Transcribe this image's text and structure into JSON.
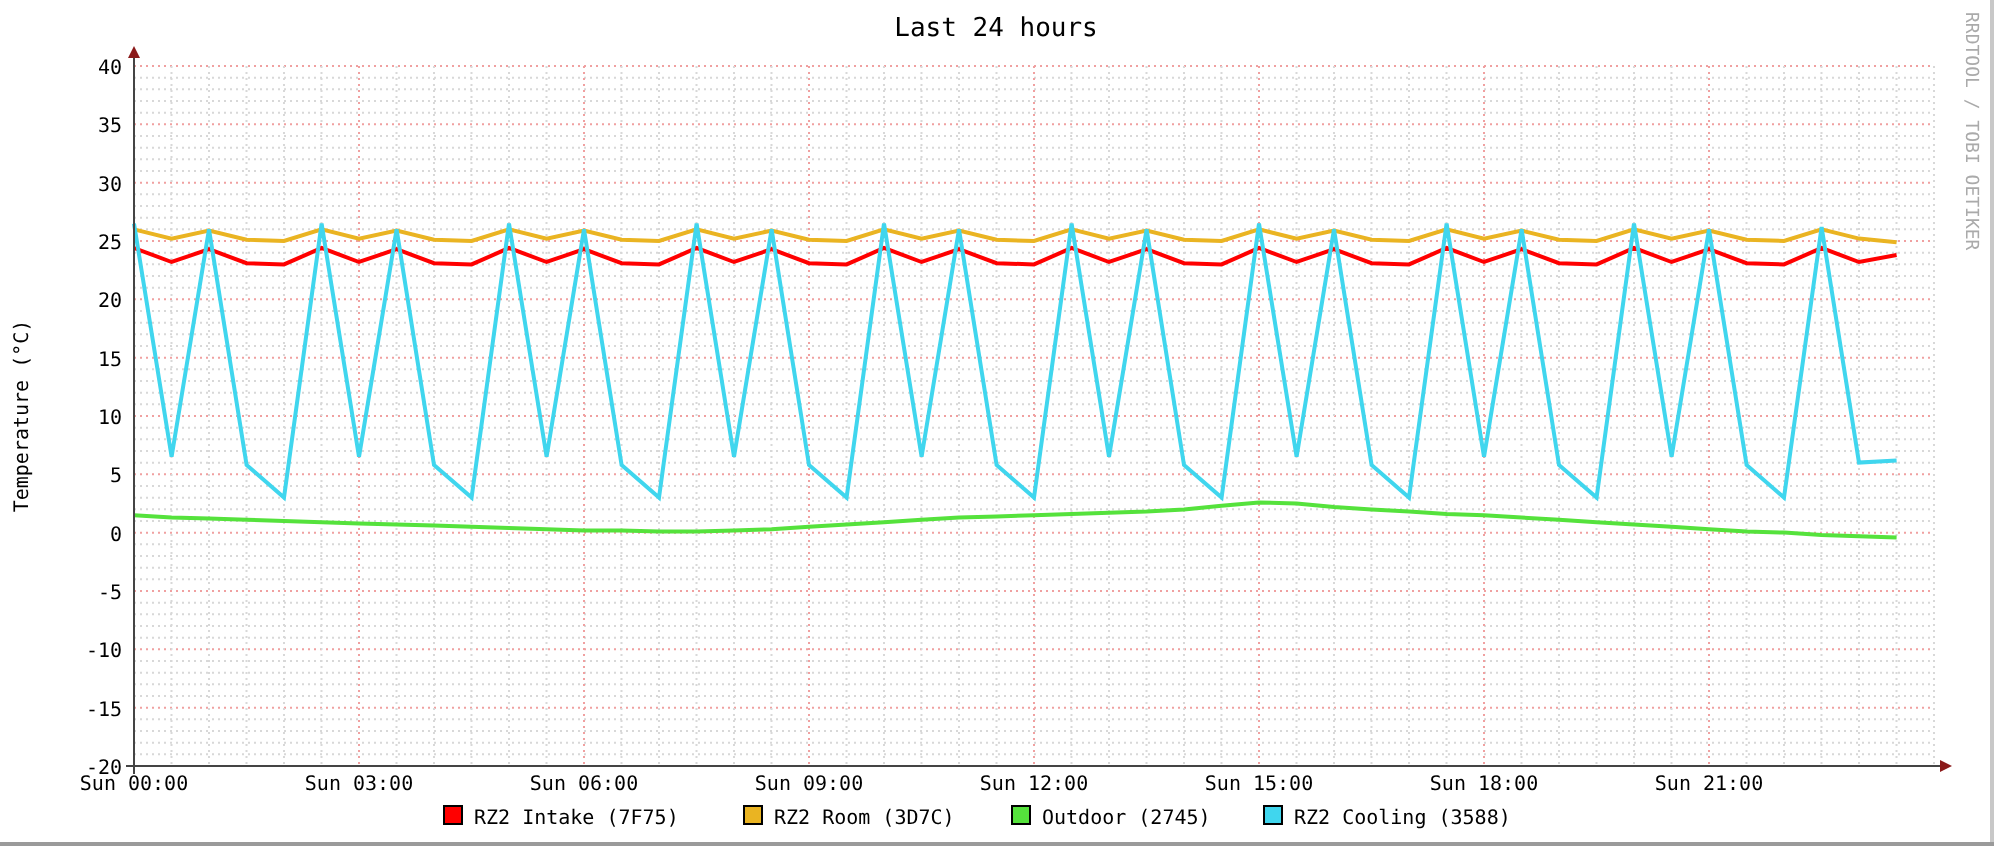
{
  "chart": {
    "chart_data": {
      "type": "line",
      "title": "Last 24 hours",
      "ylabel": "Temperature (°C)",
      "categories": [
        "Sun 00:00",
        null,
        null,
        null,
        null,
        null,
        "Sun 03:00",
        null,
        null,
        null,
        null,
        null,
        "Sun 06:00",
        null,
        null,
        null,
        null,
        null,
        "Sun 09:00",
        null,
        null,
        null,
        null,
        null,
        "Sun 12:00",
        null,
        null,
        null,
        null,
        null,
        "Sun 15:00",
        null,
        null,
        null,
        null,
        null,
        "Sun 18:00",
        null,
        null,
        null,
        null,
        null,
        "Sun 21:00",
        null,
        null,
        null,
        null,
        null
      ],
      "ylim": [
        -20,
        40
      ],
      "grid": true,
      "legend": "bottom",
      "yticks": [
        -20,
        -15,
        -10,
        -5,
        0,
        5,
        10,
        15,
        20,
        25,
        30,
        35,
        40
      ],
      "series": [
        {
          "name": "RZ2 Intake (7F75)",
          "color": "#ff0000",
          "values": [
            24.4,
            23.2,
            24.3,
            23.1,
            23.0,
            24.4,
            23.2,
            24.3,
            23.1,
            23.0,
            24.4,
            23.2,
            24.3,
            23.1,
            23.0,
            24.4,
            23.2,
            24.3,
            23.1,
            23.0,
            24.4,
            23.2,
            24.3,
            23.1,
            23.0,
            24.4,
            23.2,
            24.3,
            23.1,
            23.0,
            24.4,
            23.2,
            24.3,
            23.1,
            23.0,
            24.4,
            23.2,
            24.3,
            23.1,
            23.0,
            24.4,
            23.2,
            24.3,
            23.1,
            23.0,
            24.4,
            23.2,
            23.8
          ]
        },
        {
          "name": "RZ2 Room (3D7C)",
          "color": "#eab422",
          "values": [
            26.0,
            25.2,
            25.9,
            25.1,
            25.0,
            26.0,
            25.2,
            25.9,
            25.1,
            25.0,
            26.0,
            25.2,
            25.9,
            25.1,
            25.0,
            26.0,
            25.2,
            25.9,
            25.1,
            25.0,
            26.0,
            25.2,
            25.9,
            25.1,
            25.0,
            26.0,
            25.2,
            25.9,
            25.1,
            25.0,
            26.0,
            25.2,
            25.9,
            25.1,
            25.0,
            26.0,
            25.2,
            25.9,
            25.1,
            25.0,
            26.0,
            25.2,
            25.9,
            25.1,
            25.0,
            26.0,
            25.2,
            24.9
          ]
        },
        {
          "name": "Outdoor (2745)",
          "color": "#55e23c",
          "values": [
            1.5,
            1.3,
            1.2,
            1.1,
            1.0,
            0.9,
            0.8,
            0.7,
            0.6,
            0.5,
            0.4,
            0.3,
            0.2,
            0.2,
            0.1,
            0.1,
            0.2,
            0.3,
            0.5,
            0.7,
            0.9,
            1.1,
            1.3,
            1.4,
            1.5,
            1.6,
            1.7,
            1.8,
            2.0,
            2.3,
            2.6,
            2.5,
            2.2,
            2.0,
            1.8,
            1.6,
            1.5,
            1.3,
            1.1,
            0.9,
            0.7,
            0.5,
            0.3,
            0.1,
            0.0,
            -0.2,
            -0.3,
            -0.4
          ]
        },
        {
          "name": "RZ2 Cooling (3588)",
          "color": "#40d6ee",
          "values": [
            26.5,
            6.5,
            26.0,
            5.8,
            3.0,
            26.5,
            6.5,
            26.0,
            5.8,
            3.0,
            26.5,
            6.5,
            26.0,
            5.8,
            3.0,
            26.5,
            6.5,
            26.0,
            5.8,
            3.0,
            26.5,
            6.5,
            26.0,
            5.8,
            3.0,
            26.5,
            6.5,
            26.0,
            5.8,
            3.0,
            26.5,
            6.5,
            26.0,
            5.8,
            3.0,
            26.5,
            6.5,
            26.0,
            5.8,
            3.0,
            26.5,
            6.5,
            26.0,
            5.8,
            3.0,
            26.2,
            6.0,
            6.2
          ]
        }
      ]
    }
  },
  "credit": "RRDTOOL / TOBI OETIKER"
}
